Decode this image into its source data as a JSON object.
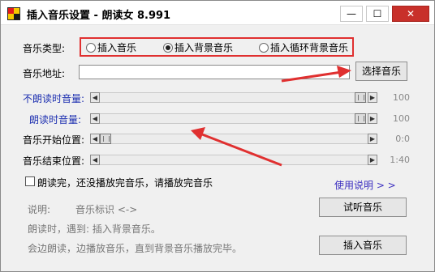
{
  "window": {
    "title": "插入音乐设置 - 朗读女 8.991",
    "controls": {
      "minimize": "—",
      "maximize": "☐",
      "close": "✕"
    }
  },
  "music_type": {
    "label": "音乐类型:",
    "options": [
      {
        "label": "插入音乐",
        "selected": false
      },
      {
        "label": "插入背景音乐",
        "selected": true
      },
      {
        "label": "插入循环背景音乐",
        "selected": false
      }
    ]
  },
  "music_address": {
    "label": "音乐地址:",
    "value": "",
    "button": "选择音乐"
  },
  "sliders": [
    {
      "label": "不朗读时音量:",
      "value": "100",
      "level": 0.97,
      "color": "#1d2fb0"
    },
    {
      "label": "朗读时音量:",
      "value": "100",
      "level": 0.97,
      "color": "#1d2fb0"
    },
    {
      "label": "音乐开始位置:",
      "value": "0:0",
      "level": 0.0,
      "color": "#000000"
    },
    {
      "label": "音乐结束位置:",
      "value": "1:40",
      "level": 0.0,
      "color": "#000000"
    }
  ],
  "checkbox": {
    "label": "朗读完，还没播放完音乐，请播放完音乐",
    "checked": false
  },
  "help_link": "使用说明 > >",
  "preview_button": "试听音乐",
  "insert_button": "插入音乐",
  "description": {
    "line1_prefix": "说明:",
    "line1_tag": "音乐标识 <->",
    "line2": "朗读时，遇到: 插入背景音乐。",
    "line3": "会边朗读，边播放音乐，直到背景音乐播放完毕。"
  },
  "accent_color": "#e03030"
}
